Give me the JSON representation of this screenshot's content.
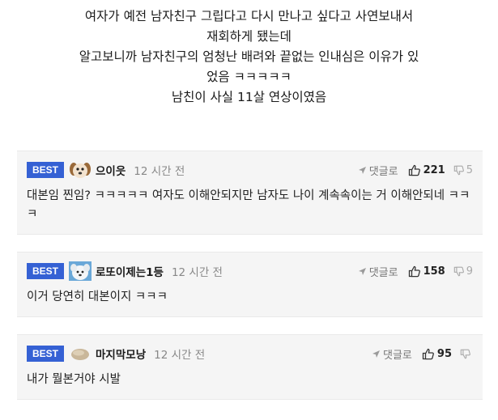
{
  "post": {
    "lines": [
      "여자가 예전 남자친구 그립다고 다시 만나고 싶다고 사연보내서",
      "재회하게 됐는데",
      "알고보니까 남자친구의 엄청난 배려와 끝없는 인내심은 이유가 있",
      "었음 ㅋㅋㅋㅋㅋ",
      "남친이 사실 11살 연상이였음"
    ]
  },
  "comments": [
    {
      "badge": "BEST",
      "avatar": "dog-avatar",
      "nickname": "으이읏",
      "time": "12 시간 전",
      "reply_label": "댓글로",
      "likes": "221",
      "dislikes": "5",
      "body": "대본임 찐임? ㅋㅋㅋㅋㅋ 여자도 이해안되지만 남자도 나이 계속속이는 거 이해안되네 ㅋㅋㅋ"
    },
    {
      "badge": "BEST",
      "avatar": "white-dog-avatar",
      "nickname": "로또이제는1등",
      "time": "12 시간 전",
      "reply_label": "댓글로",
      "likes": "158",
      "dislikes": "9",
      "body": "이거 당연히 대본이지 ㅋㅋㅋ"
    },
    {
      "badge": "BEST",
      "avatar": "stone-avatar",
      "nickname": "마지막모낭",
      "time": "12 시간 전",
      "reply_label": "댓글로",
      "likes": "95",
      "dislikes": "",
      "body": "내가 뭘본거야 시발"
    }
  ],
  "colors": {
    "best_badge": "#3561d4",
    "comment_bg": "#f5f5f5"
  }
}
